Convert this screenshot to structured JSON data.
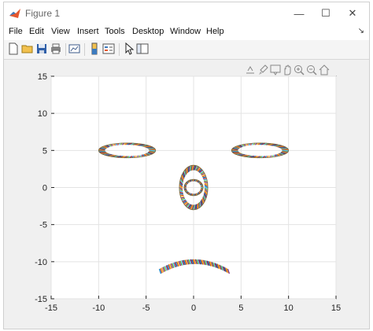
{
  "window": {
    "title": "Figure 1",
    "minimize": "—",
    "maximize": "☐",
    "close": "✕"
  },
  "menubar": {
    "items": [
      {
        "label": "File"
      },
      {
        "label": "Edit"
      },
      {
        "label": "View"
      },
      {
        "label": "Insert"
      },
      {
        "label": "Tools"
      },
      {
        "label": "Desktop"
      },
      {
        "label": "Window"
      },
      {
        "label": "Help"
      }
    ],
    "dock_glyph": "↘"
  },
  "toolbar": {
    "buttons": [
      "new-figure-icon",
      "open-file-icon",
      "save-icon",
      "print-icon",
      "link-plot-icon",
      "insert-colorbar-icon",
      "insert-legend-icon",
      "edit-plot-icon",
      "property-inspector-icon"
    ]
  },
  "axes_toolbar": {
    "buttons": [
      "export-icon",
      "brush-icon",
      "data-tips-icon",
      "pan-icon",
      "zoom-in-icon",
      "zoom-out-icon",
      "restore-view-icon"
    ]
  },
  "chart_data": {
    "type": "line",
    "title": "",
    "xlabel": "",
    "ylabel": "",
    "xlim": [
      -15,
      15
    ],
    "ylim": [
      -15,
      15
    ],
    "xticks": [
      -15,
      -10,
      -5,
      0,
      5,
      10,
      15
    ],
    "yticks": [
      -15,
      -10,
      -5,
      0,
      5,
      10,
      15
    ],
    "grid": true,
    "shapes": [
      {
        "name": "left-eye",
        "kind": "ellipse",
        "center": [
          -7,
          5
        ],
        "radii": [
          3,
          1
        ]
      },
      {
        "name": "right-eye",
        "kind": "ellipse",
        "center": [
          7,
          5
        ],
        "radii": [
          3,
          1
        ]
      },
      {
        "name": "nose-outer",
        "kind": "ellipse",
        "center": [
          0,
          0
        ],
        "radii": [
          1.5,
          3
        ]
      },
      {
        "name": "nose-inner",
        "kind": "ellipse",
        "center": [
          0,
          0
        ],
        "radii": [
          1,
          1.1
        ]
      },
      {
        "name": "mouth",
        "kind": "arc",
        "x_range": [
          -3.6,
          3.6
        ],
        "y_peak": -10,
        "y_ends": [
          -11.3,
          -11.3
        ]
      }
    ]
  }
}
